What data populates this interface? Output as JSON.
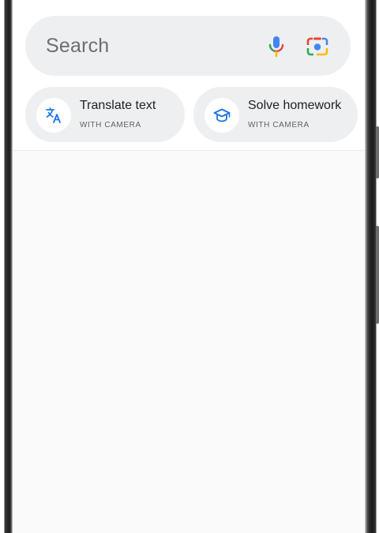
{
  "search": {
    "placeholder": "Search",
    "mic_icon": "mic-icon",
    "lens_icon": "google-lens-icon"
  },
  "chips": [
    {
      "title": "Translate text",
      "subtitle": "WITH CAMERA",
      "icon": "translate-icon"
    },
    {
      "title": "Solve homework",
      "subtitle": "WITH CAMERA",
      "icon": "graduation-cap-icon"
    }
  ],
  "colors": {
    "search_bg": "#edeff1",
    "placeholder_text": "#6b6f73",
    "accent_blue": "#1a73e8",
    "google_red": "#ea4335",
    "google_yellow": "#fbbc04",
    "google_green": "#34a853"
  }
}
